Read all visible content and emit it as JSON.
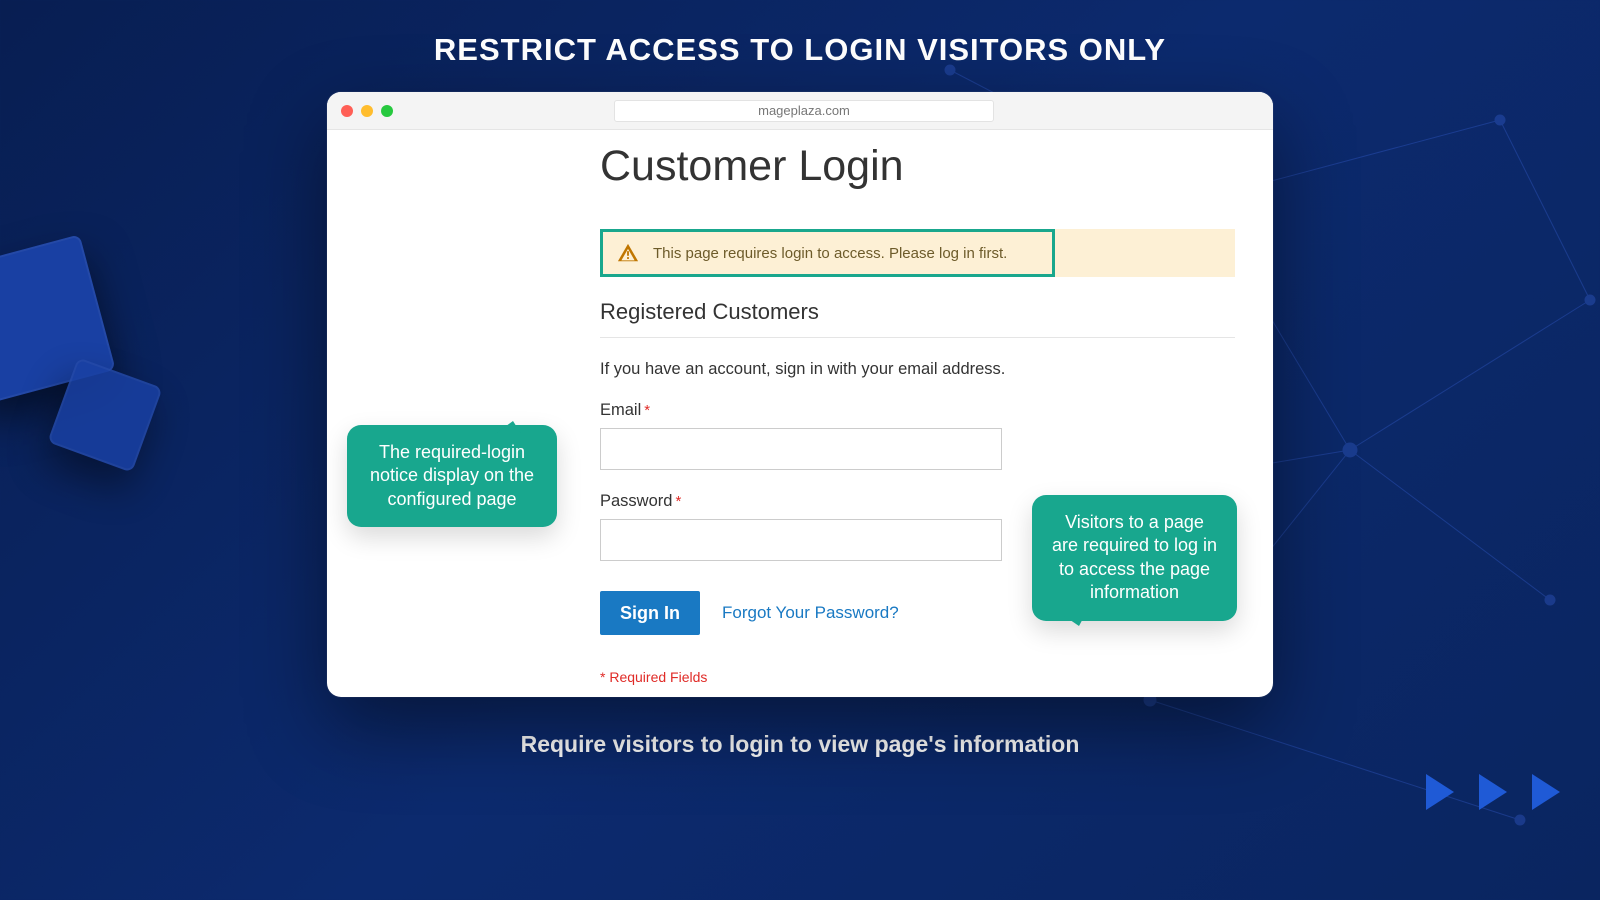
{
  "heading": "RESTRICT ACCESS TO LOGIN VISITORS ONLY",
  "caption": "Require visitors to login to view page's information",
  "traffic_lights": {
    "close": "close-icon",
    "minimize": "minimize-icon",
    "zoom": "zoom-icon"
  },
  "address_bar": {
    "url": "mageplaza.com"
  },
  "page": {
    "title": "Customer Login",
    "alert": {
      "icon": "warning-icon",
      "text": "This page requires login to access. Please log in first."
    },
    "section_title": "Registered Customers",
    "section_sub": "If you have an account, sign in with your email address.",
    "email": {
      "label": "Email",
      "required_mark": "*",
      "value": ""
    },
    "password": {
      "label": "Password",
      "required_mark": "*",
      "value": ""
    },
    "signin_label": "Sign In",
    "forgot_label": "Forgot Your Password?",
    "required_note": "* Required Fields"
  },
  "callouts": {
    "left": "The required-login notice display on the configured page",
    "right": "Visitors to a page are required to log in to access the page information"
  },
  "colors": {
    "accent_teal": "#18a78e",
    "alert_bg": "#fdf0d5",
    "primary_button": "#1979c3",
    "link": "#1979c3",
    "danger": "#e02b27",
    "bg_navy": "#0a2560"
  }
}
